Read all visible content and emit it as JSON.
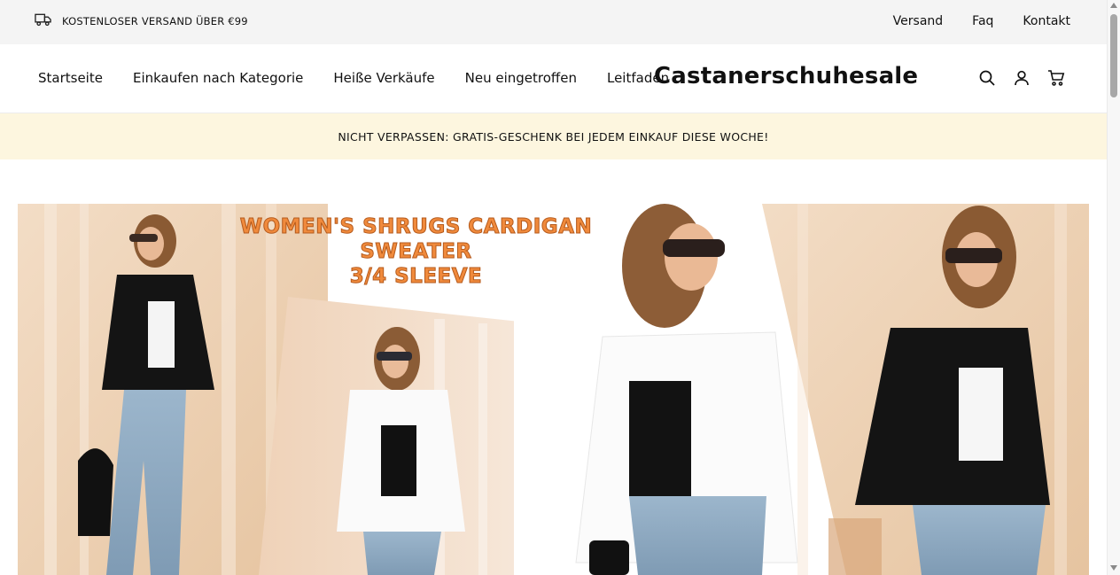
{
  "topbar": {
    "shipping_text": "KOSTENLOSER VERSAND ÜBER €99",
    "shipping_icon": "truck-icon",
    "links": [
      "Versand",
      "Faq",
      "Kontakt"
    ]
  },
  "nav": {
    "items": [
      "Startseite",
      "Einkaufen nach Kategorie",
      "Heiße Verkäufe",
      "Neu eingetroffen",
      "Leitfaden"
    ],
    "brand": "Castanerschuhesale",
    "icons": [
      "search-icon",
      "account-icon",
      "cart-icon"
    ]
  },
  "promo": {
    "text": "NICHT VERPASSEN: GRATIS-GESCHENK BEI JEDEM EINKAUF DIESE WOCHE!"
  },
  "hero": {
    "title_line1": "WOMEN'S SHRUGS CARDIGAN SWEATER",
    "title_line2": "3/4 SLEEVE"
  },
  "colors": {
    "topbar_bg": "#f4f4f4",
    "promo_bg": "#fdf6df",
    "hero_title": "#f08a3c"
  }
}
